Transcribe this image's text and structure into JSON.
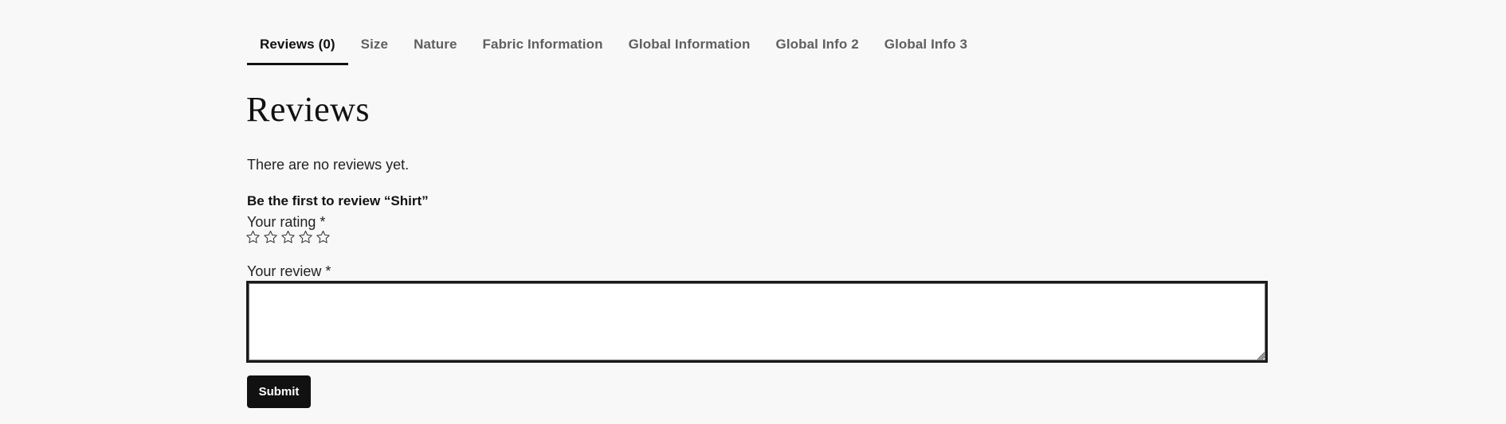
{
  "tabs": [
    {
      "label": "Reviews (0)",
      "active": true
    },
    {
      "label": "Size",
      "active": false
    },
    {
      "label": "Nature",
      "active": false
    },
    {
      "label": "Fabric Information",
      "active": false
    },
    {
      "label": "Global Information",
      "active": false
    },
    {
      "label": "Global Info 2",
      "active": false
    },
    {
      "label": "Global Info 3",
      "active": false
    }
  ],
  "reviews": {
    "title": "Reviews",
    "empty_message": "There are no reviews yet.",
    "reply_title": "Be the first to review “Shirt”",
    "rating_label": "Your rating *",
    "rating": {
      "value": 0,
      "max": 5,
      "icon": "star-outline-icon"
    },
    "review_label": "Your review *",
    "review_value": "",
    "submit_label": "Submit"
  },
  "colors": {
    "background": "#f8f8f8",
    "text": "#111111",
    "tab_inactive": "#5f5f5f",
    "button_bg": "#111111",
    "button_text": "#ffffff"
  }
}
